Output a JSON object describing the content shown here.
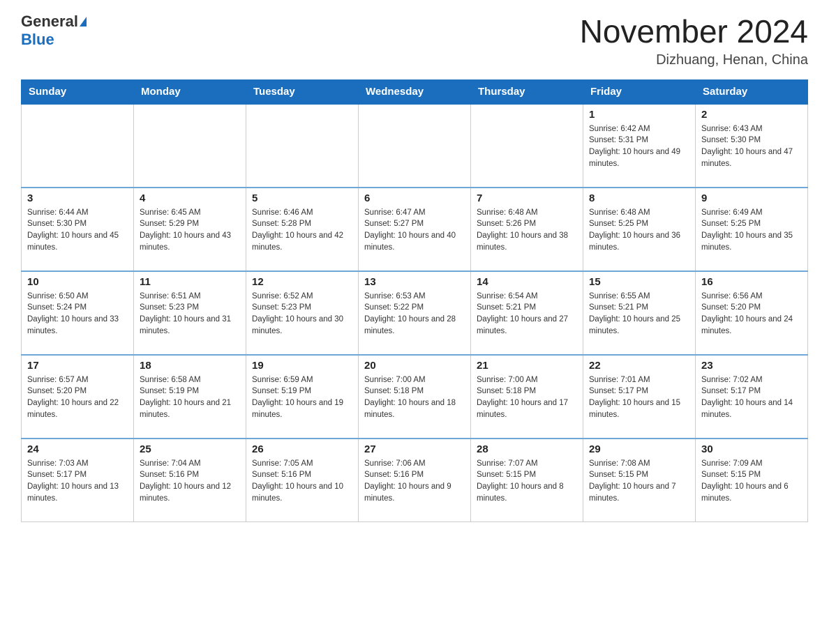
{
  "header": {
    "logo_main": "General",
    "logo_sub": "Blue",
    "month_title": "November 2024",
    "location": "Dizhuang, Henan, China"
  },
  "weekdays": [
    "Sunday",
    "Monday",
    "Tuesday",
    "Wednesday",
    "Thursday",
    "Friday",
    "Saturday"
  ],
  "weeks": [
    [
      {
        "day": "",
        "sunrise": "",
        "sunset": "",
        "daylight": ""
      },
      {
        "day": "",
        "sunrise": "",
        "sunset": "",
        "daylight": ""
      },
      {
        "day": "",
        "sunrise": "",
        "sunset": "",
        "daylight": ""
      },
      {
        "day": "",
        "sunrise": "",
        "sunset": "",
        "daylight": ""
      },
      {
        "day": "",
        "sunrise": "",
        "sunset": "",
        "daylight": ""
      },
      {
        "day": "1",
        "sunrise": "Sunrise: 6:42 AM",
        "sunset": "Sunset: 5:31 PM",
        "daylight": "Daylight: 10 hours and 49 minutes."
      },
      {
        "day": "2",
        "sunrise": "Sunrise: 6:43 AM",
        "sunset": "Sunset: 5:30 PM",
        "daylight": "Daylight: 10 hours and 47 minutes."
      }
    ],
    [
      {
        "day": "3",
        "sunrise": "Sunrise: 6:44 AM",
        "sunset": "Sunset: 5:30 PM",
        "daylight": "Daylight: 10 hours and 45 minutes."
      },
      {
        "day": "4",
        "sunrise": "Sunrise: 6:45 AM",
        "sunset": "Sunset: 5:29 PM",
        "daylight": "Daylight: 10 hours and 43 minutes."
      },
      {
        "day": "5",
        "sunrise": "Sunrise: 6:46 AM",
        "sunset": "Sunset: 5:28 PM",
        "daylight": "Daylight: 10 hours and 42 minutes."
      },
      {
        "day": "6",
        "sunrise": "Sunrise: 6:47 AM",
        "sunset": "Sunset: 5:27 PM",
        "daylight": "Daylight: 10 hours and 40 minutes."
      },
      {
        "day": "7",
        "sunrise": "Sunrise: 6:48 AM",
        "sunset": "Sunset: 5:26 PM",
        "daylight": "Daylight: 10 hours and 38 minutes."
      },
      {
        "day": "8",
        "sunrise": "Sunrise: 6:48 AM",
        "sunset": "Sunset: 5:25 PM",
        "daylight": "Daylight: 10 hours and 36 minutes."
      },
      {
        "day": "9",
        "sunrise": "Sunrise: 6:49 AM",
        "sunset": "Sunset: 5:25 PM",
        "daylight": "Daylight: 10 hours and 35 minutes."
      }
    ],
    [
      {
        "day": "10",
        "sunrise": "Sunrise: 6:50 AM",
        "sunset": "Sunset: 5:24 PM",
        "daylight": "Daylight: 10 hours and 33 minutes."
      },
      {
        "day": "11",
        "sunrise": "Sunrise: 6:51 AM",
        "sunset": "Sunset: 5:23 PM",
        "daylight": "Daylight: 10 hours and 31 minutes."
      },
      {
        "day": "12",
        "sunrise": "Sunrise: 6:52 AM",
        "sunset": "Sunset: 5:23 PM",
        "daylight": "Daylight: 10 hours and 30 minutes."
      },
      {
        "day": "13",
        "sunrise": "Sunrise: 6:53 AM",
        "sunset": "Sunset: 5:22 PM",
        "daylight": "Daylight: 10 hours and 28 minutes."
      },
      {
        "day": "14",
        "sunrise": "Sunrise: 6:54 AM",
        "sunset": "Sunset: 5:21 PM",
        "daylight": "Daylight: 10 hours and 27 minutes."
      },
      {
        "day": "15",
        "sunrise": "Sunrise: 6:55 AM",
        "sunset": "Sunset: 5:21 PM",
        "daylight": "Daylight: 10 hours and 25 minutes."
      },
      {
        "day": "16",
        "sunrise": "Sunrise: 6:56 AM",
        "sunset": "Sunset: 5:20 PM",
        "daylight": "Daylight: 10 hours and 24 minutes."
      }
    ],
    [
      {
        "day": "17",
        "sunrise": "Sunrise: 6:57 AM",
        "sunset": "Sunset: 5:20 PM",
        "daylight": "Daylight: 10 hours and 22 minutes."
      },
      {
        "day": "18",
        "sunrise": "Sunrise: 6:58 AM",
        "sunset": "Sunset: 5:19 PM",
        "daylight": "Daylight: 10 hours and 21 minutes."
      },
      {
        "day": "19",
        "sunrise": "Sunrise: 6:59 AM",
        "sunset": "Sunset: 5:19 PM",
        "daylight": "Daylight: 10 hours and 19 minutes."
      },
      {
        "day": "20",
        "sunrise": "Sunrise: 7:00 AM",
        "sunset": "Sunset: 5:18 PM",
        "daylight": "Daylight: 10 hours and 18 minutes."
      },
      {
        "day": "21",
        "sunrise": "Sunrise: 7:00 AM",
        "sunset": "Sunset: 5:18 PM",
        "daylight": "Daylight: 10 hours and 17 minutes."
      },
      {
        "day": "22",
        "sunrise": "Sunrise: 7:01 AM",
        "sunset": "Sunset: 5:17 PM",
        "daylight": "Daylight: 10 hours and 15 minutes."
      },
      {
        "day": "23",
        "sunrise": "Sunrise: 7:02 AM",
        "sunset": "Sunset: 5:17 PM",
        "daylight": "Daylight: 10 hours and 14 minutes."
      }
    ],
    [
      {
        "day": "24",
        "sunrise": "Sunrise: 7:03 AM",
        "sunset": "Sunset: 5:17 PM",
        "daylight": "Daylight: 10 hours and 13 minutes."
      },
      {
        "day": "25",
        "sunrise": "Sunrise: 7:04 AM",
        "sunset": "Sunset: 5:16 PM",
        "daylight": "Daylight: 10 hours and 12 minutes."
      },
      {
        "day": "26",
        "sunrise": "Sunrise: 7:05 AM",
        "sunset": "Sunset: 5:16 PM",
        "daylight": "Daylight: 10 hours and 10 minutes."
      },
      {
        "day": "27",
        "sunrise": "Sunrise: 7:06 AM",
        "sunset": "Sunset: 5:16 PM",
        "daylight": "Daylight: 10 hours and 9 minutes."
      },
      {
        "day": "28",
        "sunrise": "Sunrise: 7:07 AM",
        "sunset": "Sunset: 5:15 PM",
        "daylight": "Daylight: 10 hours and 8 minutes."
      },
      {
        "day": "29",
        "sunrise": "Sunrise: 7:08 AM",
        "sunset": "Sunset: 5:15 PM",
        "daylight": "Daylight: 10 hours and 7 minutes."
      },
      {
        "day": "30",
        "sunrise": "Sunrise: 7:09 AM",
        "sunset": "Sunset: 5:15 PM",
        "daylight": "Daylight: 10 hours and 6 minutes."
      }
    ]
  ]
}
